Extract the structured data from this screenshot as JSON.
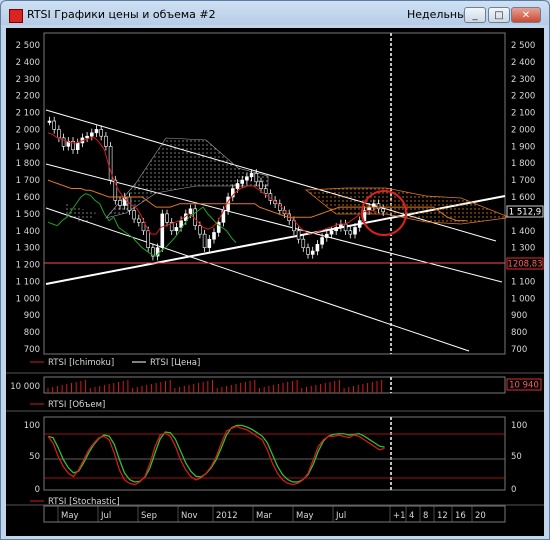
{
  "window": {
    "title": "RTSI Графики цены и объема #2",
    "period": "Недельный",
    "buttons": [
      "_",
      "□",
      "✕"
    ]
  },
  "price_panel": {
    "y_ticks": [
      "2 500",
      "2 400",
      "2 300",
      "2 200",
      "2 100",
      "2 000",
      "1 900",
      "1 800",
      "1 700",
      "1 600",
      "1 500",
      "1 400",
      "1 300",
      "1 200",
      "1 100",
      "1 000",
      "900",
      "800",
      "700"
    ],
    "y_ticks_right": [
      "2 500",
      "2 400",
      "2 300",
      "2 200",
      "2 100",
      "2 000",
      "1 900",
      "1 800",
      "1 700",
      "1 600",
      "1 500",
      "1 400",
      "1 300",
      "1 200",
      "1 100",
      "1 000",
      "900",
      "800",
      "700"
    ],
    "current_price": "1 512,9",
    "level_label": "1208,83",
    "legend": [
      "RTSI [Ichimoku]",
      "RTSI [Цена]"
    ]
  },
  "volume_panel": {
    "y_tick": "10 000",
    "value": "10 940",
    "legend": "RTSI [Объем]"
  },
  "stoch_panel": {
    "y_ticks": [
      "100",
      "50",
      "0"
    ],
    "y_ticks_right": [
      "100",
      "50",
      "0"
    ],
    "legend": "RTSI [Stochastic]"
  },
  "time_axis": [
    "May",
    "Jul",
    "Sep",
    "Nov",
    "2012",
    "Mar",
    "May",
    "Jul",
    "+1",
    "4",
    "8",
    "12",
    "16",
    "20"
  ],
  "colors": {
    "background": "#000000",
    "price_up": "#ffffff",
    "ichimoku_line": "#d21b1b",
    "cloud": "#e07a20",
    "stoch_k": "#d21b1b",
    "stoch_d": "#2fbf2f",
    "level_line": "#ff4d4d"
  }
}
